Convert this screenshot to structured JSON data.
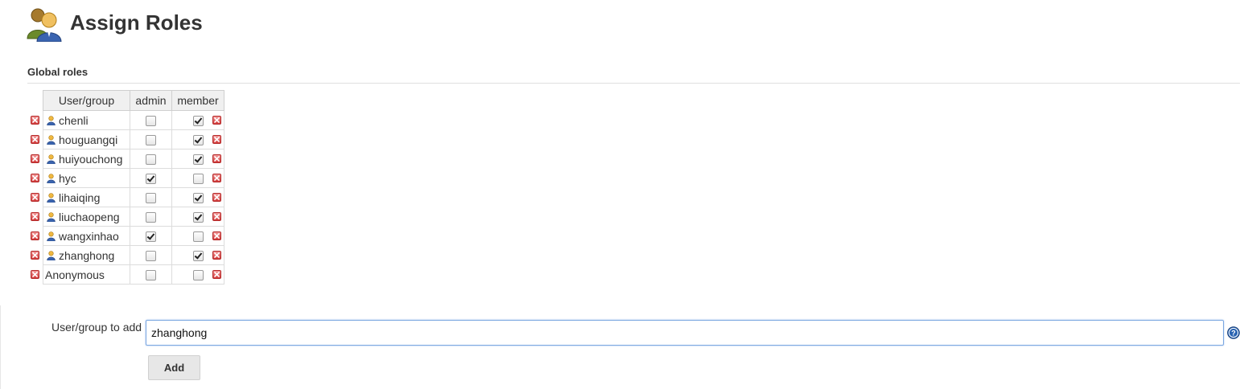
{
  "header": {
    "title": "Assign Roles",
    "icon": "user-group-icon"
  },
  "global_roles": {
    "section_title": "Global roles",
    "columns": [
      "User/group",
      "admin",
      "member"
    ],
    "rows": [
      {
        "name": "chenli",
        "is_user": true,
        "admin": false,
        "member": true
      },
      {
        "name": "houguangqi",
        "is_user": true,
        "admin": false,
        "member": true
      },
      {
        "name": "huiyouchong",
        "is_user": true,
        "admin": false,
        "member": true
      },
      {
        "name": "hyc",
        "is_user": true,
        "admin": true,
        "member": false
      },
      {
        "name": "lihaiqing",
        "is_user": true,
        "admin": false,
        "member": true
      },
      {
        "name": "liuchaopeng",
        "is_user": true,
        "admin": false,
        "member": true
      },
      {
        "name": "wangxinhao",
        "is_user": true,
        "admin": true,
        "member": false
      },
      {
        "name": "zhanghong",
        "is_user": true,
        "admin": false,
        "member": true
      },
      {
        "name": "Anonymous",
        "is_user": false,
        "admin": false,
        "member": false
      }
    ]
  },
  "add_form": {
    "label": "User/group to add",
    "value": "zhanghong",
    "button_label": "Add",
    "help_icon": "help-icon"
  },
  "colors": {
    "delete": "#d23c3c",
    "input_focus": "#7ba7e1",
    "help": "#2a64b2"
  }
}
